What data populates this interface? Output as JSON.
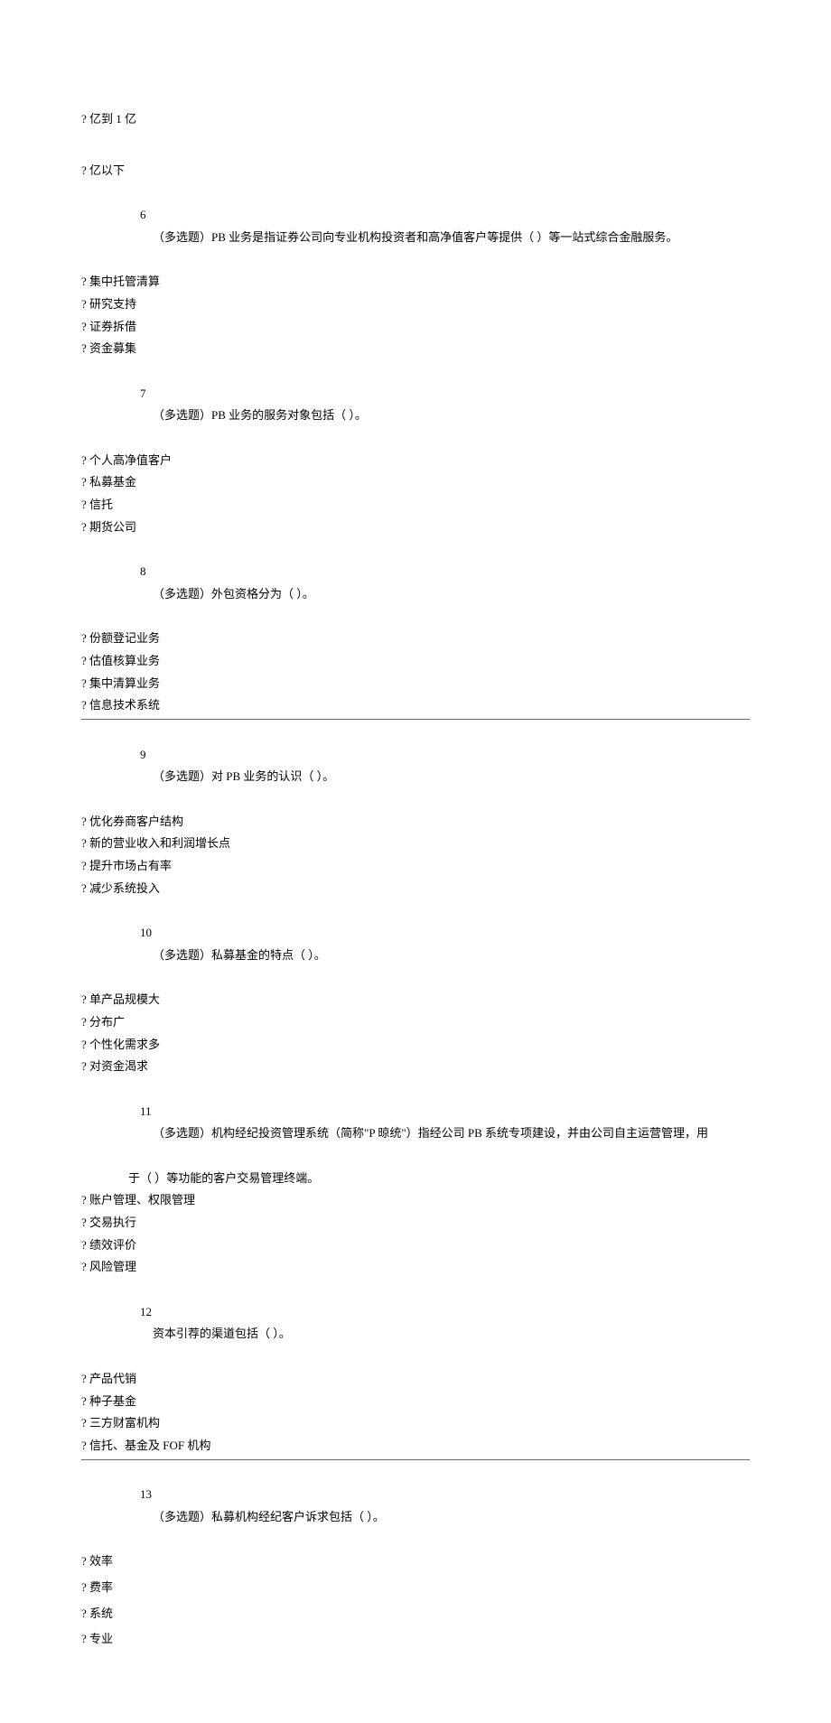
{
  "pre_options": [
    "? 亿到 1 亿",
    "? 亿以下"
  ],
  "questions": [
    {
      "num": "6",
      "tag": "（多选题）",
      "text": "PB 业务是指证券公司向专业机构投资者和高净值客户等提供（ ）等一站式综合金融服务。",
      "options": [
        "? 集中托管清算",
        "? 研究支持",
        "? 证券拆借",
        "? 资金募集"
      ]
    },
    {
      "num": "7",
      "tag": "（多选题）",
      "text": "PB 业务的服务对象包括（ ）。",
      "options": [
        "? 个人高净值客户",
        "? 私募基金",
        "? 信托",
        "? 期货公司"
      ]
    },
    {
      "num": "8",
      "tag": "（多选题）",
      "text": "外包资格分为（ ）。",
      "options": [
        "? 份额登记业务",
        "? 估值核算业务",
        "? 集中清算业务",
        "? 信息技术系统"
      ]
    },
    {
      "num": "9",
      "tag": "（多选题）",
      "text": "对 PB 业务的认识（ ）。",
      "options": [
        "? 优化券商客户结构",
        "? 新的营业收入和利润增长点",
        "? 提升市场占有率",
        "? 减少系统投入"
      ]
    },
    {
      "num": "10",
      "tag": "（多选题）",
      "text": "私募基金的特点（ ）。",
      "options": [
        "? 单产品规模大",
        "? 分布广",
        "? 个性化需求多",
        "? 对资金渴求"
      ]
    },
    {
      "num": "11",
      "tag": "（多选题）",
      "text": "机构经纪投资管理系统（简称\"P 晾统\"）指经公司 PB 系统专项建设，并由公司自主运营管理，用",
      "text2": "于（ ）等功能的客户交易管理终端。",
      "options": [
        "? 账户管理、权限管理",
        "? 交易执行",
        "? 绩效评价",
        "? 风险管理"
      ]
    },
    {
      "num": "12",
      "tag": "",
      "text": "资本引荐的渠道包括（ ）。",
      "options": [
        "? 产品代销",
        "? 种子基金",
        "? 三方财富机构",
        "? 信托、基金及 FOF 机构"
      ]
    },
    {
      "num": "13",
      "tag": "（多选题）",
      "text": "私募机构经纪客户诉求包括（ ）。",
      "options": [
        "? 效率",
        "? 费率",
        "? 系统",
        "? 专业"
      ]
    }
  ]
}
